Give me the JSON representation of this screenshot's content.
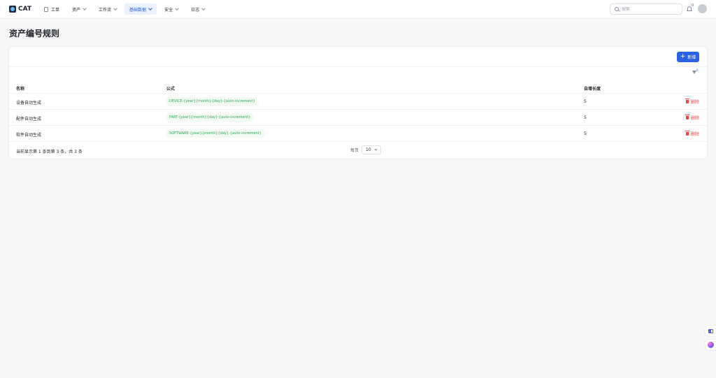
{
  "app": {
    "name": "CAT"
  },
  "nav": {
    "items": [
      {
        "label": "工单",
        "icon": "document-icon",
        "dropdown": false,
        "active": false
      },
      {
        "label": "资产",
        "dropdown": true,
        "active": false
      },
      {
        "label": "工作流",
        "dropdown": true,
        "active": false
      },
      {
        "label": "基础数据",
        "dropdown": true,
        "active": true
      },
      {
        "label": "安全",
        "dropdown": true,
        "active": false
      },
      {
        "label": "日志",
        "dropdown": true,
        "active": false
      }
    ]
  },
  "header": {
    "search_placeholder": "搜索",
    "notification_count": "0"
  },
  "page": {
    "title": "资产编号规则"
  },
  "toolbar": {
    "add_label": "新增",
    "filter_count": "0"
  },
  "table": {
    "columns": [
      "名称",
      "公式",
      "自增长度"
    ],
    "rows": [
      {
        "name": "设备自动生成",
        "formula": "DEVICE-{year}{month}{day}-{auto-increment}",
        "length": "5",
        "action": "删除"
      },
      {
        "name": "配件自动生成",
        "formula": "PART-{year}{month}{day}-{auto-increment}",
        "length": "5",
        "action": "删除"
      },
      {
        "name": "软件自动生成",
        "formula": "SOFTWARE-{year}{month}{day}-{auto-increment}",
        "length": "5",
        "action": "删除"
      }
    ]
  },
  "pagination": {
    "summary": "当前显示第 1 条到第 3 条，共 3 条",
    "per_page_label": "每页",
    "per_page_value": "10"
  },
  "colors": {
    "primary": "#2b62e3",
    "danger": "#e54545",
    "tag_text": "#2fa84f",
    "tag_bg": "#f2fbf3"
  }
}
